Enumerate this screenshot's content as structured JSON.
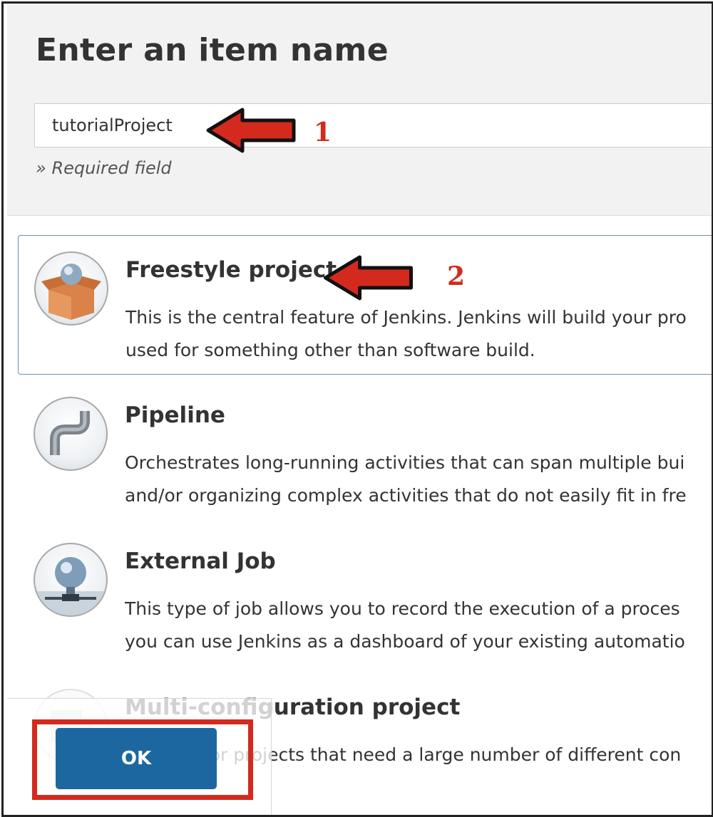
{
  "page": {
    "title": "Enter an item name"
  },
  "name_field": {
    "value": "tutorialProject",
    "required_note": "» Required field"
  },
  "items": [
    {
      "title": "Freestyle project",
      "desc_line1": "This is the central feature of Jenkins. Jenkins will build your pro",
      "desc_line2": "used for something other than software build.",
      "icon": "freestyle-box-icon",
      "selected": true
    },
    {
      "title": "Pipeline",
      "desc_line1": "Orchestrates long-running activities that can span multiple bui",
      "desc_line2": "and/or organizing complex activities that do not easily fit in fre",
      "icon": "pipeline-pipe-icon",
      "selected": false
    },
    {
      "title": "External Job",
      "desc_line1": "This type of job allows you to record the execution of a proces",
      "desc_line2": "you can use Jenkins as a dashboard of your existing automatio",
      "icon": "external-job-icon",
      "selected": false
    },
    {
      "title": "Multi-configuration project",
      "desc_line1": "Suitable for projects that need a large number of different con",
      "desc_line2": "",
      "icon": "multi-config-icon",
      "selected": false
    }
  ],
  "annotations": {
    "step1": "1",
    "step2": "2"
  },
  "ok_button": {
    "label": "OK"
  },
  "colors": {
    "annotation_red": "#d42a1e",
    "ok_blue": "#1d67a0",
    "selected_border": "#6a8fb0",
    "header_bg": "#f2f2f2"
  }
}
